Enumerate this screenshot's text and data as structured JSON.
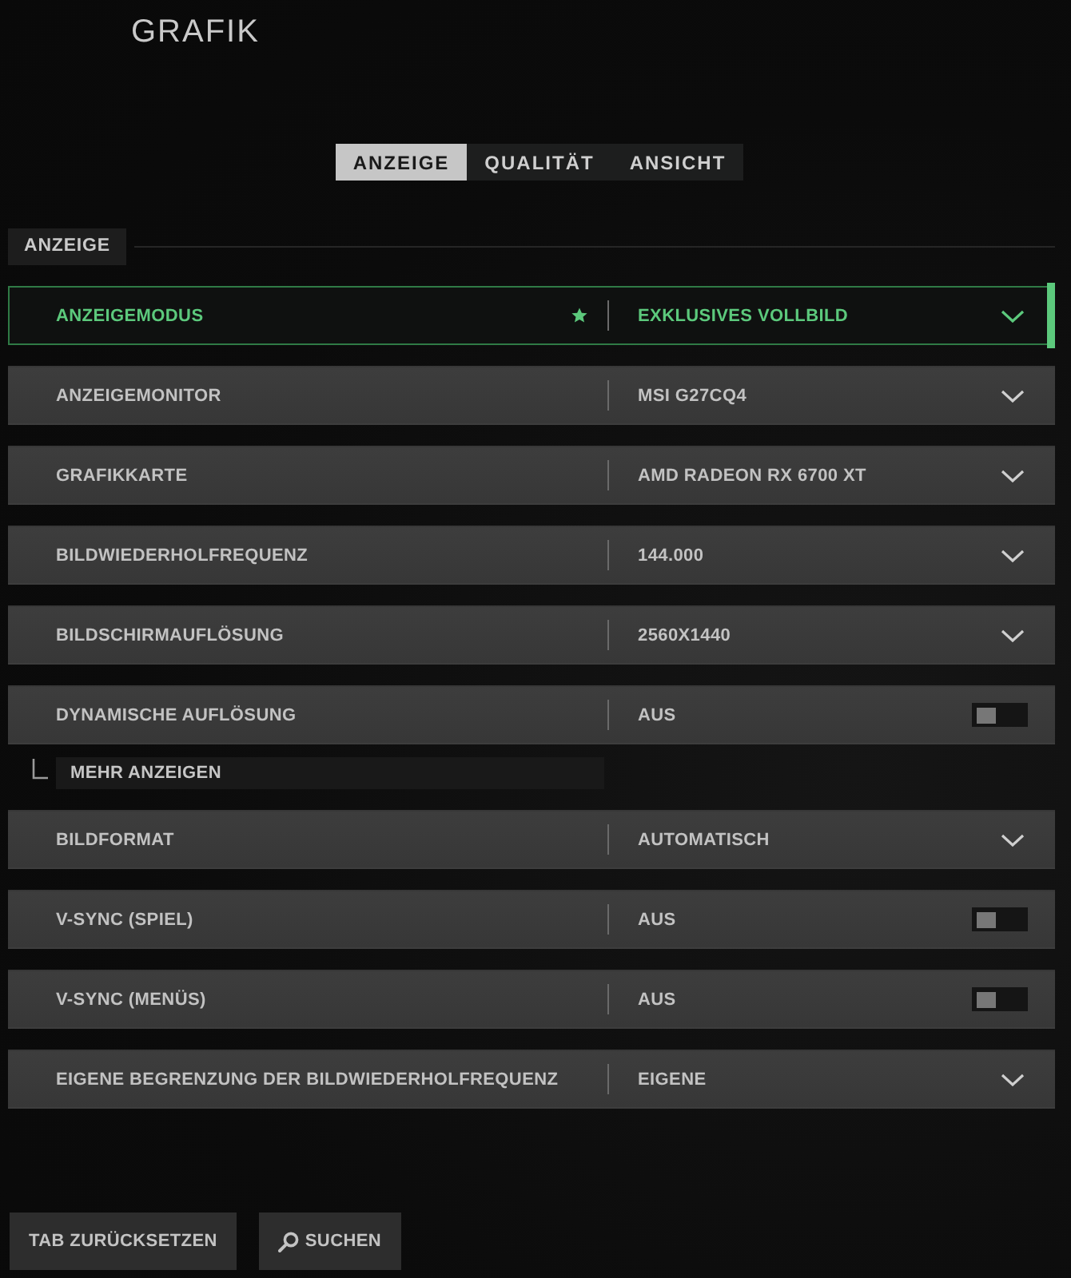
{
  "title": "GRAFIK",
  "tabs": [
    {
      "label": "ANZEIGE",
      "selected": true
    },
    {
      "label": "QUALITÄT",
      "selected": false
    },
    {
      "label": "ANSICHT",
      "selected": false
    }
  ],
  "section": {
    "label": "ANZEIGE"
  },
  "settings": [
    {
      "kind": "dropdown",
      "label": "ANZEIGEMODUS",
      "value": "EXKLUSIVES VOLLBILD",
      "selected": true,
      "starred": true
    },
    {
      "kind": "dropdown",
      "label": "ANZEIGEMONITOR",
      "value": "MSI G27CQ4",
      "selected": false,
      "starred": false
    },
    {
      "kind": "dropdown",
      "label": "GRAFIKKARTE",
      "value": "AMD RADEON RX 6700 XT",
      "selected": false,
      "starred": false
    },
    {
      "kind": "dropdown",
      "label": "BILDWIEDERHOLFREQUENZ",
      "value": "144.000",
      "selected": false,
      "starred": false
    },
    {
      "kind": "dropdown",
      "label": "BILDSCHIRMAUFLÖSUNG",
      "value": "2560X1440",
      "selected": false,
      "starred": false
    },
    {
      "kind": "toggle",
      "label": "DYNAMISCHE AUFLÖSUNG",
      "value": "AUS",
      "on": false,
      "selected": false,
      "starred": false
    },
    {
      "kind": "link",
      "label": "MEHR ANZEIGEN"
    },
    {
      "kind": "dropdown",
      "label": "BILDFORMAT",
      "value": "AUTOMATISCH",
      "selected": false,
      "starred": false
    },
    {
      "kind": "toggle",
      "label": "V-SYNC (SPIEL)",
      "value": "AUS",
      "on": false,
      "selected": false,
      "starred": false
    },
    {
      "kind": "toggle",
      "label": "V-SYNC (MENÜS)",
      "value": "AUS",
      "on": false,
      "selected": false,
      "starred": false
    },
    {
      "kind": "dropdown",
      "label": "EIGENE BEGRENZUNG DER BILDWIEDERHOLFREQUENZ",
      "value": "EIGENE",
      "selected": false,
      "starred": false
    }
  ],
  "buttons": [
    {
      "kind": "plain",
      "label": "TAB ZURÜCKSETZEN"
    },
    {
      "kind": "search",
      "label": "SUCHEN"
    }
  ]
}
